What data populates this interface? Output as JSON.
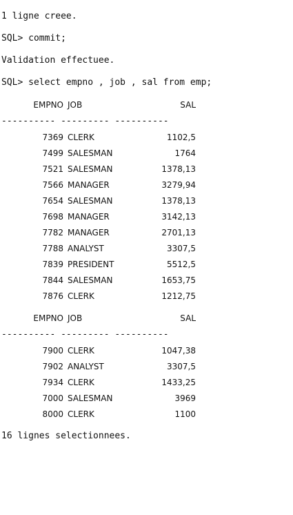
{
  "console": {
    "line_insert": "1 ligne creee.",
    "line_commit_cmd": "SQL> commit;",
    "line_validation": "Validation effectuee.",
    "line_select_cmd": "SQL> select empno , job , sal from emp;",
    "line_footer": "16 lignes selectionnees."
  },
  "result": {
    "headers": {
      "empno": "EMPNO",
      "job": "JOB",
      "sal": "SAL"
    },
    "separator": "---------- --------- ----------",
    "pages": [
      {
        "rows": [
          {
            "empno": "7369",
            "job": "CLERK",
            "sal": "1102,5"
          },
          {
            "empno": "7499",
            "job": "SALESMAN",
            "sal": "1764"
          },
          {
            "empno": "7521",
            "job": "SALESMAN",
            "sal": "1378,13"
          },
          {
            "empno": "7566",
            "job": "MANAGER",
            "sal": "3279,94"
          },
          {
            "empno": "7654",
            "job": "SALESMAN",
            "sal": "1378,13"
          },
          {
            "empno": "7698",
            "job": "MANAGER",
            "sal": "3142,13"
          },
          {
            "empno": "7782",
            "job": "MANAGER",
            "sal": "2701,13"
          },
          {
            "empno": "7788",
            "job": "ANALYST",
            "sal": "3307,5"
          },
          {
            "empno": "7839",
            "job": "PRESIDENT",
            "sal": "5512,5"
          },
          {
            "empno": "7844",
            "job": "SALESMAN",
            "sal": "1653,75"
          },
          {
            "empno": "7876",
            "job": "CLERK",
            "sal": "1212,75"
          }
        ]
      },
      {
        "rows": [
          {
            "empno": "7900",
            "job": "CLERK",
            "sal": "1047,38"
          },
          {
            "empno": "7902",
            "job": "ANALYST",
            "sal": "3307,5"
          },
          {
            "empno": "7934",
            "job": "CLERK",
            "sal": "1433,25"
          },
          {
            "empno": "7000",
            "job": "SALESMAN",
            "sal": "3969"
          },
          {
            "empno": "8000",
            "job": "CLERK",
            "sal": "1100"
          }
        ]
      }
    ]
  }
}
